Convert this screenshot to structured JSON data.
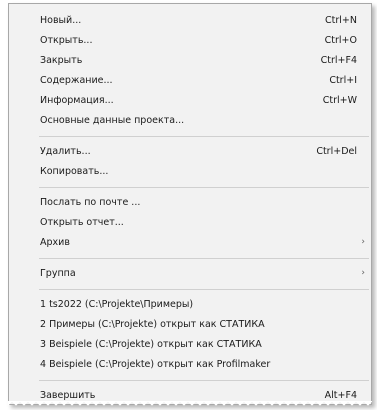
{
  "menu": {
    "group1": [
      {
        "label": "Новый...",
        "shortcut": "Ctrl+N"
      },
      {
        "label": "Открыть...",
        "shortcut": "Ctrl+O"
      },
      {
        "label": "Закрыть",
        "shortcut": "Ctrl+F4"
      },
      {
        "label": "Содержание...",
        "shortcut": "Ctrl+I"
      },
      {
        "label": "Информация...",
        "shortcut": "Ctrl+W"
      },
      {
        "label": "Основные данные проекта...",
        "shortcut": ""
      }
    ],
    "group2": [
      {
        "label": "Удалить...",
        "shortcut": "Ctrl+Del"
      },
      {
        "label": "Копировать...",
        "shortcut": ""
      }
    ],
    "group3": [
      {
        "label": "Послать по почте ...",
        "shortcut": ""
      },
      {
        "label": "Открыть отчет...",
        "shortcut": ""
      },
      {
        "label": "Архив",
        "submenu_arrow": "›"
      }
    ],
    "group4": [
      {
        "label": "Группа",
        "submenu_arrow": "›"
      }
    ],
    "recent": [
      {
        "label": "1 ts2022 (C:\\Projekte\\Примеры)"
      },
      {
        "label": "2 Примеры (C:\\Projekte) открыт как СТАТИКА"
      },
      {
        "label": "3 Beispiele (C:\\Projekte) открыт как СТАТИКА"
      },
      {
        "label": "4 Beispiele (C:\\Projekte) открыт как Profilmaker"
      }
    ],
    "exit": {
      "label": "Завершить",
      "shortcut": "Alt+F4"
    }
  }
}
